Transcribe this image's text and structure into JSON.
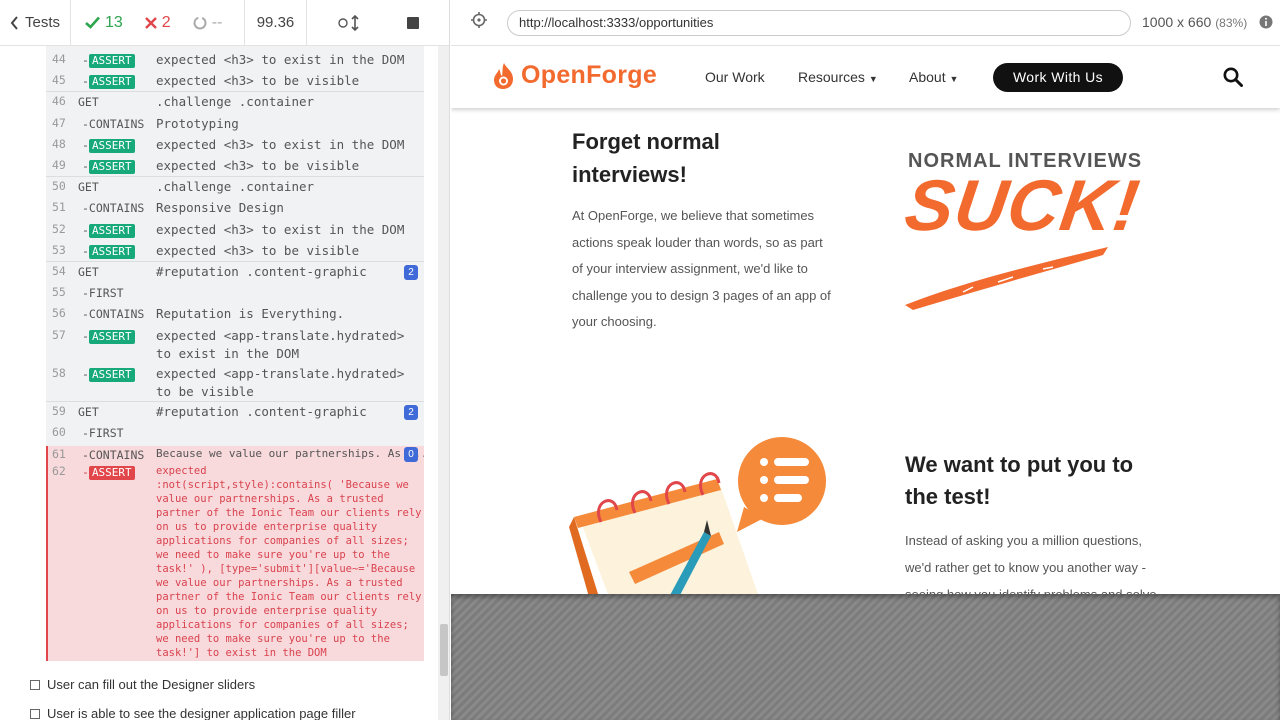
{
  "reporter": {
    "tests_label": "Tests",
    "passed": "13",
    "failed": "2",
    "pending": "--",
    "duration": "99.36"
  },
  "commands": [
    {
      "num": "44",
      "name": "ASSERT",
      "msg_html": "expected <h3> to exist in the DOM"
    },
    {
      "num": "45",
      "name": "ASSERT",
      "msg_html": "expected <h3> to be visible"
    },
    {
      "num": "46",
      "name": "GET",
      "msg": ".challenge .container"
    },
    {
      "num": "47",
      "name": "-CONTAINS",
      "msg": "Prototyping"
    },
    {
      "num": "48",
      "name": "ASSERT",
      "msg_html": "expected <h3> to exist in the DOM"
    },
    {
      "num": "49",
      "name": "ASSERT",
      "msg_html": "expected <h3> to be visible"
    },
    {
      "num": "50",
      "name": "GET",
      "msg": ".challenge .container"
    },
    {
      "num": "51",
      "name": "-CONTAINS",
      "msg": "Responsive Design"
    },
    {
      "num": "52",
      "name": "ASSERT",
      "msg_html": "expected <h3> to exist in the DOM"
    },
    {
      "num": "53",
      "name": "ASSERT",
      "msg_html": "expected <h3> to be visible"
    },
    {
      "num": "54",
      "name": "GET",
      "msg": "#reputation .content-graphic",
      "count": "2"
    },
    {
      "num": "55",
      "name": "-FIRST",
      "msg": ""
    },
    {
      "num": "56",
      "name": "-CONTAINS",
      "msg": "Reputation is Everything."
    },
    {
      "num": "57",
      "name": "ASSERT",
      "msg_line1": "expected <app-translate.hydrated>",
      "msg_line2": "to exist in the DOM"
    },
    {
      "num": "58",
      "name": "ASSERT",
      "msg_line1": "expected <app-translate.hydrated>",
      "msg_line2": "to be visible"
    },
    {
      "num": "59",
      "name": "GET",
      "msg": "#reputation .content-graphic",
      "count": "2"
    },
    {
      "num": "60",
      "name": "-FIRST",
      "msg": ""
    }
  ],
  "failed_cmd": {
    "num_contains": "61",
    "contains_name": "-CONTAINS",
    "contains_msg": "Because we value our partnerships. As ...",
    "contains_count": "0",
    "num_assert": "62",
    "assert_name": "ASSERT",
    "assert_lines": [
      "expected",
      ":not(script,style):contains( 'Because we",
      "value our partnerships. As a trusted",
      "partner of the Ionic Team our clients rely",
      "on us to provide enterprise quality",
      "applications for companies of all sizes;",
      "we need to make sure you're up to the",
      "task!' ), [type='submit'][value~='Because",
      "we value our partnerships. As a trusted",
      "partner of the Ionic Team our clients rely",
      "on us to provide enterprise quality",
      "applications for companies of all sizes;",
      "we need to make sure you're up to the",
      "task!'] to exist in the DOM"
    ]
  },
  "tests": [
    "User can fill out the Designer sliders",
    "User is able to see the designer application page filler"
  ],
  "preview": {
    "url": "http://localhost:3333/opportunities",
    "viewport": "1000 x 660",
    "scale": "(83%)"
  },
  "site": {
    "logo": "OpenForge",
    "nav": [
      "Our Work",
      "Resources",
      "About"
    ],
    "cta": "Work With Us",
    "section1_title": "Forget normal interviews!",
    "section1_body": "At OpenForge, we believe that sometimes actions speak louder than words, so as part of your interview assignment, we'd like to challenge you to design 3 pages of an app of your choosing.",
    "graphic_heading": "NORMAL INTERVIEWS",
    "graphic_word": "SUCK!",
    "section2_title": "We want to put you to the test!",
    "section2_body": "Instead of asking you a million questions, we'd rather get to know you another way - seeing how you identify problems and solve"
  },
  "colors": {
    "brand_orange": "#f26a2e",
    "pass_green": "#2ea44f",
    "fail_red": "#e0464a",
    "assert_green": "#18a97b"
  }
}
